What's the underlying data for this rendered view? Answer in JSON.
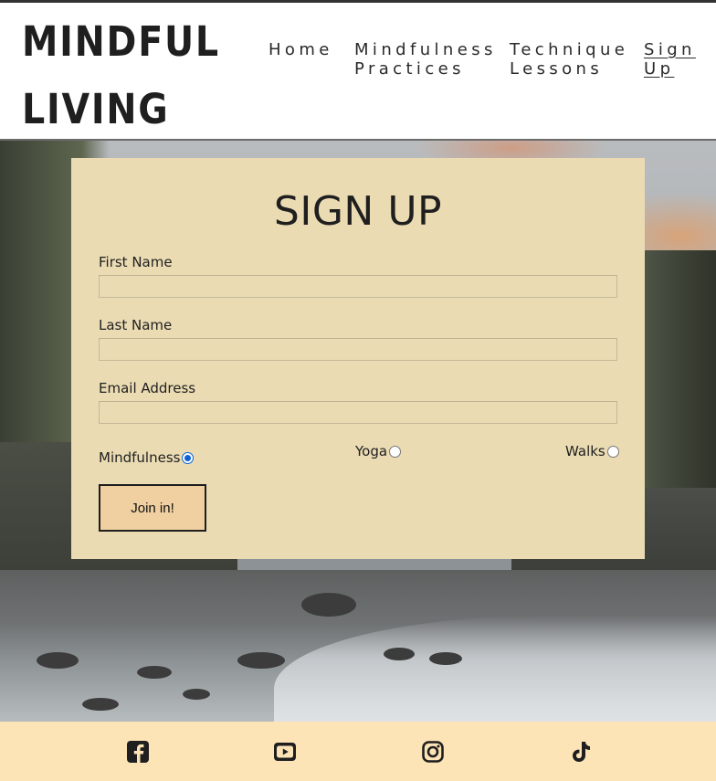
{
  "brand": {
    "line1": "MINDFUL",
    "line2": "LIVING"
  },
  "nav": [
    {
      "lines": [
        "Home"
      ]
    },
    {
      "lines": [
        "Mindfulness",
        "Practices"
      ]
    },
    {
      "lines": [
        "Technique",
        "Lessons"
      ]
    },
    {
      "lines": [
        "Sign",
        "Up"
      ],
      "active": true
    }
  ],
  "signup": {
    "title": "SIGN UP",
    "first_name_label": "First Name",
    "first_name_value": "",
    "last_name_label": "Last Name",
    "last_name_value": "",
    "email_label": "Email Address",
    "email_value": "",
    "interests": [
      {
        "label": "Mindfulness",
        "checked": true
      },
      {
        "label": "Yoga",
        "checked": false
      },
      {
        "label": "Walks",
        "checked": false
      }
    ],
    "submit_label": "Join in!"
  },
  "footer": {
    "icons": [
      "facebook-icon",
      "youtube-icon",
      "instagram-icon",
      "tiktok-icon"
    ]
  },
  "colors": {
    "card_bg": "#eadbb3",
    "button_bg": "#f0cfa0",
    "footer_bg": "#fde4b7",
    "radio_checked": "#0b62d6"
  }
}
